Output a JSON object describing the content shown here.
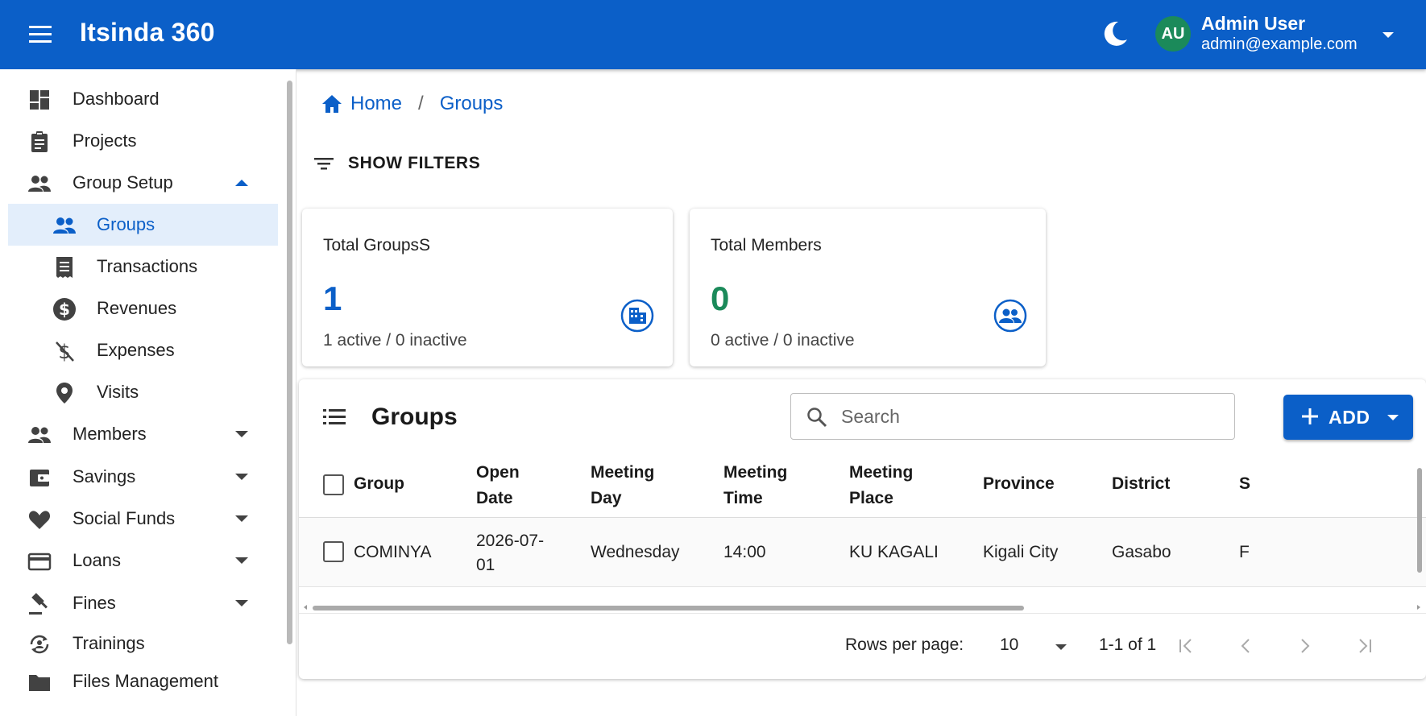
{
  "colors": {
    "primary": "#0b5fc8",
    "groups_value": "#0b5fc8",
    "members_value": "#1b8a5a",
    "avatar_bg": "#1b8a5a"
  },
  "app": {
    "title": "Itsinda 360",
    "menu_icon": "hamburger-menu-icon",
    "theme_icon": "moon-icon",
    "user": {
      "initials": "AU",
      "name": "Admin User",
      "email": "admin@example.com"
    }
  },
  "sidebar": {
    "items": [
      {
        "label": "Dashboard",
        "icon": "dashboard-icon"
      },
      {
        "label": "Projects",
        "icon": "clipboard-icon"
      },
      {
        "label": "Group Setup",
        "icon": "people-icon",
        "expanded": true
      },
      {
        "label": "Groups",
        "icon": "people-icon",
        "active": true
      },
      {
        "label": "Transactions",
        "icon": "receipt-icon"
      },
      {
        "label": "Revenues",
        "icon": "dollar-circle-icon"
      },
      {
        "label": "Expenses",
        "icon": "money-off-icon"
      },
      {
        "label": "Visits",
        "icon": "location-pin-icon"
      },
      {
        "label": "Members",
        "icon": "people-icon",
        "expanded": false
      },
      {
        "label": "Savings",
        "icon": "wallet-icon",
        "expanded": false
      },
      {
        "label": "Social Funds",
        "icon": "heart-icon",
        "expanded": false
      },
      {
        "label": "Loans",
        "icon": "credit-card-icon",
        "expanded": false
      },
      {
        "label": "Fines",
        "icon": "gavel-icon",
        "expanded": false
      },
      {
        "label": "Trainings",
        "icon": "training-cycle-icon"
      },
      {
        "label": "Files Management",
        "icon": "folder-icon"
      }
    ]
  },
  "breadcrumb": {
    "home": "Home",
    "separator": "/",
    "current": "Groups"
  },
  "filters": {
    "label": "SHOW FILTERS"
  },
  "stats": {
    "groups": {
      "title": "Total GroupsS",
      "value": "1",
      "sub": "1 active / 0 inactive",
      "icon": "building-icon"
    },
    "members": {
      "title": "Total Members",
      "value": "0",
      "sub": "0 active / 0 inactive",
      "icon": "group-circle-icon"
    }
  },
  "table": {
    "title": "Groups",
    "search_placeholder": "Search",
    "add_label": "ADD",
    "columns": [
      {
        "l1": "Group",
        "l2": ""
      },
      {
        "l1": "Open",
        "l2": "Date"
      },
      {
        "l1": "Meeting",
        "l2": "Day"
      },
      {
        "l1": "Meeting",
        "l2": "Time"
      },
      {
        "l1": "Meeting",
        "l2": "Place"
      },
      {
        "l1": "Province",
        "l2": ""
      },
      {
        "l1": "District",
        "l2": ""
      },
      {
        "l1": "S",
        "l2": ""
      }
    ],
    "rows": [
      {
        "group": "COMINYA",
        "open_date_1": "2026-07-",
        "open_date_2": "01",
        "meeting_day": "Wednesday",
        "meeting_time": "14:00",
        "meeting_place": "KU KAGALI",
        "province": "Kigali City",
        "district": "Gasabo",
        "s": "F"
      }
    ],
    "pagination": {
      "rows_per_page_label": "Rows per page:",
      "rows_per_page": "10",
      "range": "1-1 of 1"
    }
  }
}
